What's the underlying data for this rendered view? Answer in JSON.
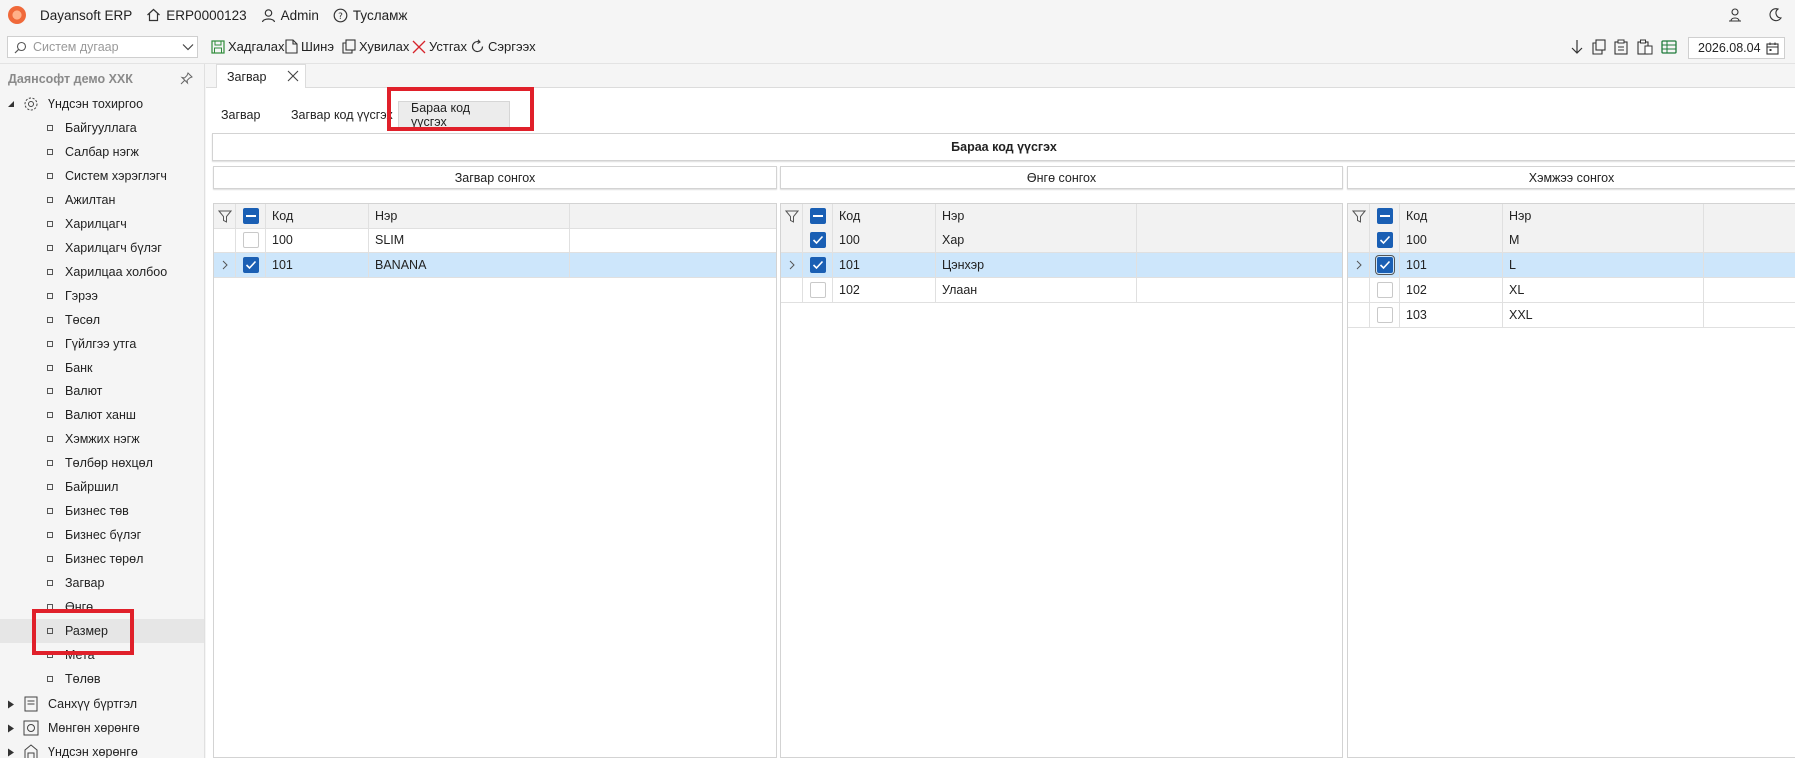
{
  "topbar": {
    "app_name": "Dayansoft ERP",
    "company_code": "ERP0000123",
    "user": "Admin",
    "help": "Тусламж"
  },
  "toolbar": {
    "search_placeholder": "Систем дугаар",
    "save": "Хадгалах",
    "new": "Шинэ",
    "copy": "Хувилах",
    "delete": "Устгах",
    "refresh": "Сэргээх",
    "date": "2026.08.04"
  },
  "sidebar": {
    "company": "Даянсофт демо ХХК",
    "main_group": "Үндсэн тохиргоо",
    "items": [
      "Байгууллага",
      "Салбар нэгж",
      "Систем хэрэглэгч",
      "Ажилтан",
      "Харилцагч",
      "Харилцагч бүлэг",
      "Харилцаа холбоо",
      "Гэрээ",
      "Төсөл",
      "Гүйлгээ утга",
      "Банк",
      "Валют",
      "Валют ханш",
      "Хэмжих нэгж",
      "Төлбөр нөхцөл",
      "Байршил",
      "Бизнес төв",
      "Бизнес бүлэг",
      "Бизнес төрөл",
      "Загвар",
      "Өнгө",
      "Размер",
      "Мета",
      "Төлөв"
    ],
    "groups": [
      "Санхүү бүртгэл",
      "Мөнгөн хөрөнгө",
      "Үндсэн хөрөнгө"
    ]
  },
  "doc_tab": "Загвар",
  "subtabs": [
    "Загвар",
    "Загвар код үүсгэх",
    "Бараа код үүсгэх"
  ],
  "panel_title": "Бараа код үүсгэх",
  "sections": [
    "Загвар сонгох",
    "Өнгө сонгох",
    "Хэмжээ сонгох"
  ],
  "columns": {
    "code": "Код",
    "name": "Нэр"
  },
  "grids": [
    {
      "rows": [
        {
          "code": "100",
          "name": "SLIM",
          "checked": false
        },
        {
          "code": "101",
          "name": "BANANA",
          "checked": true
        }
      ]
    },
    {
      "rows": [
        {
          "code": "100",
          "name": "Хар",
          "checked": true
        },
        {
          "code": "101",
          "name": "Цэнхэр",
          "checked": true
        },
        {
          "code": "102",
          "name": "Улаан",
          "checked": false
        }
      ]
    },
    {
      "rows": [
        {
          "code": "100",
          "name": "M",
          "checked": true
        },
        {
          "code": "101",
          "name": "L",
          "checked": true
        },
        {
          "code": "102",
          "name": "XL",
          "checked": false
        },
        {
          "code": "103",
          "name": "XXL",
          "checked": false
        }
      ]
    }
  ],
  "colors": {
    "accent": "#1a5fb4",
    "selection": "#cde6fb",
    "highlight": "#e0202a"
  }
}
